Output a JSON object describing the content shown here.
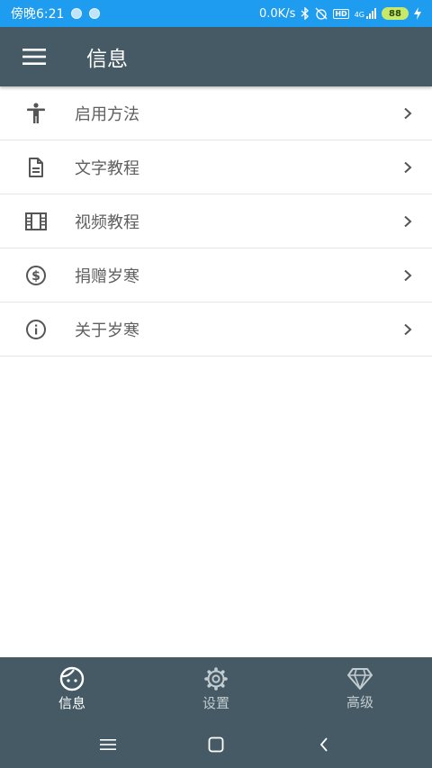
{
  "status": {
    "time": "傍晚6:21",
    "network_speed": "0.0K/s",
    "network_type": "4G",
    "battery": "88",
    "hd": "HD"
  },
  "header": {
    "title": "信息"
  },
  "menu": {
    "items": [
      {
        "label": "启用方法",
        "icon": "accessibility-icon"
      },
      {
        "label": "文字教程",
        "icon": "document-icon"
      },
      {
        "label": "视频教程",
        "icon": "film-icon"
      },
      {
        "label": "捐赠岁寒",
        "icon": "dollar-circle-icon"
      },
      {
        "label": "关于岁寒",
        "icon": "info-icon"
      }
    ]
  },
  "bottom_nav": {
    "tabs": [
      {
        "label": "信息",
        "icon": "face-icon",
        "active": true
      },
      {
        "label": "设置",
        "icon": "gear-icon",
        "active": false
      },
      {
        "label": "高级",
        "icon": "diamond-icon",
        "active": false
      }
    ]
  },
  "colors": {
    "status_bar": "#1e9cf0",
    "app_bar": "#455a64",
    "icon": "#555555"
  }
}
